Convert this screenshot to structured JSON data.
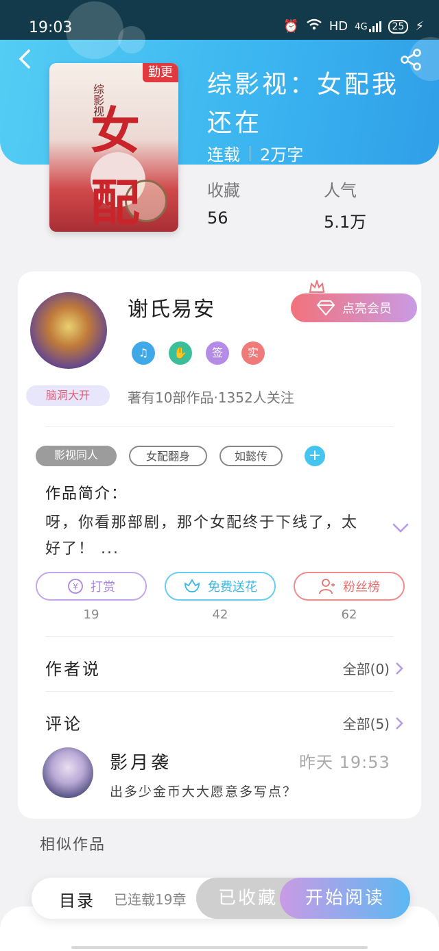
{
  "status_bar": {
    "time": "19:03",
    "network": "HD",
    "signal": "4G",
    "battery": "25"
  },
  "colors": {
    "header_blue": "#3bb4f0",
    "vip_pink": "#f2727b",
    "vip_purple": "#c99be5",
    "accent_cyan": "#45c4ef",
    "reward_purple": "#b79be3",
    "flower_cyan": "#45c4ef",
    "fans_red": "#ef8b8b"
  },
  "book": {
    "cover_tag": "勤更",
    "cover_title": "女配",
    "cover_sub": "综影视",
    "title": "综影视：女配我还在",
    "status": "连载",
    "word_count": "2万字",
    "stats": [
      {
        "label": "收藏",
        "value": "56"
      },
      {
        "label": "人气",
        "value": "5.1万"
      }
    ]
  },
  "author": {
    "name": "谢氏易安",
    "vip_button": "点亮会员",
    "badge": "脑洞大开",
    "badges": [
      {
        "icon": "music-note-icon",
        "text": "♫",
        "color": "#3fa9e8"
      },
      {
        "icon": "handshake-icon",
        "text": "✋",
        "color": "#3bbf9a"
      },
      {
        "icon": "sign-icon",
        "text": "签",
        "color": "#b48be6"
      },
      {
        "icon": "verified-icon",
        "text": "实",
        "color": "#f07a7a"
      }
    ],
    "description": "著有10部作品·1352人关注"
  },
  "tags": [
    "影视同人",
    "女配翻身",
    "如懿传"
  ],
  "intro": {
    "label": "作品简介：",
    "text": "呀，你看那部剧，那个女配终于下线了，太好了！ ..."
  },
  "actions": [
    {
      "label": "打赏",
      "icon": "yuan-icon",
      "count": "19"
    },
    {
      "label": "免费送花",
      "icon": "flower-icon",
      "count": "42"
    },
    {
      "label": "粉丝榜",
      "icon": "fans-icon",
      "count": "62"
    }
  ],
  "author_says": {
    "title": "作者说",
    "link": "全部(0)"
  },
  "comments": {
    "title": "评论",
    "link": "全部(5)",
    "items": [
      {
        "user": "影月袭",
        "time": "昨天 19:53",
        "text": "出多少金币大大愿意多写点？"
      }
    ]
  },
  "similar": {
    "title": "相似作品"
  },
  "bottom": {
    "toc": "目录",
    "toc_status": "已连载19章",
    "collected": "已收藏",
    "read": "开始阅读"
  }
}
